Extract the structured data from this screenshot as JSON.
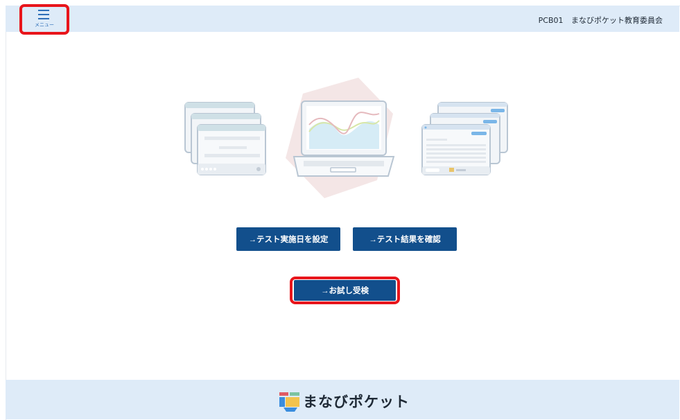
{
  "header": {
    "menu_label": "メニュー",
    "school_code": "PCB01",
    "organization": "まなびポケット教育委員会"
  },
  "actions": {
    "set_test_date": "→テスト実施日を設定",
    "check_results": "→テスト結果を確認",
    "trial_exam": "→お試し受検"
  },
  "footer": {
    "brand": "まなびポケット"
  },
  "colors": {
    "header_bg": "#deebf8",
    "button_bg": "#124f8c",
    "highlight_border": "#e8151b"
  },
  "icons": [
    "menu-icon",
    "dashboard-illustration",
    "manabi-pocket-logo"
  ]
}
